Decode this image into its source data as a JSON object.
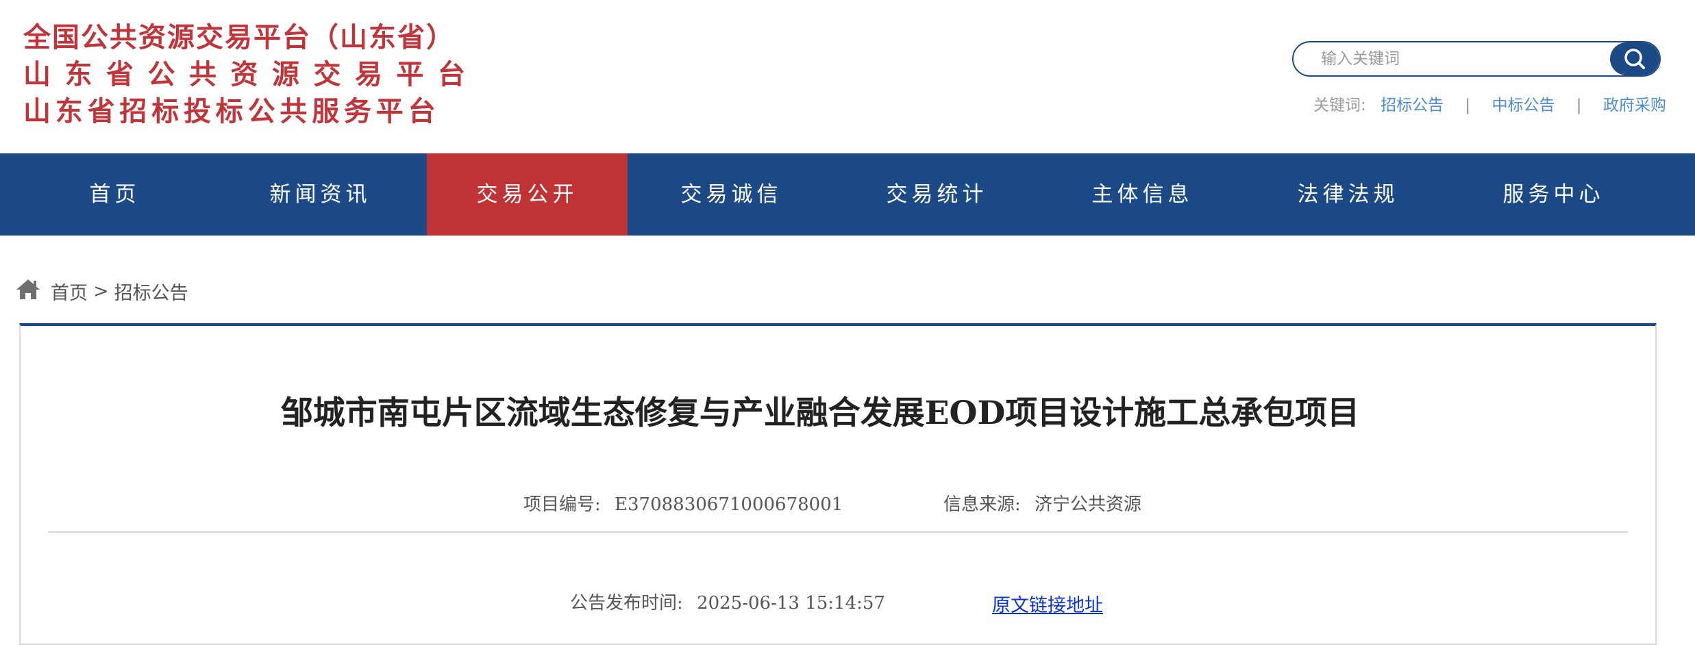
{
  "header": {
    "logo_lines": [
      "全国公共资源交易平台（山东省）",
      "山东省公共资源交易平台",
      "山东省招标投标公共服务平台"
    ],
    "search": {
      "placeholder": "输入关键词",
      "value": "",
      "button_icon": "search-icon"
    },
    "keywords": {
      "label": "关键词:",
      "items": [
        "招标公告",
        "中标公告",
        "政府采购"
      ],
      "separator": "|"
    }
  },
  "nav": {
    "items": [
      "首页",
      "新闻资讯",
      "交易公开",
      "交易诚信",
      "交易统计",
      "主体信息",
      "法律法规",
      "服务中心"
    ],
    "active_index": 2
  },
  "breadcrumb": {
    "icon": "home-icon",
    "items": [
      "首页",
      "招标公告"
    ],
    "separator": ">"
  },
  "article": {
    "title": "邹城市南屯片区流域生态修复与产业融合发展EOD项目设计施工总承包项目",
    "project_no_label": "项目编号:",
    "project_no_value": "E3708830671000678001",
    "source_label": "信息来源:",
    "source_value": "济宁公共资源",
    "publish_time_label": "公告发布时间:",
    "publish_time_value": "2025-06-13 15:14:57",
    "original_link": "原文链接地址"
  },
  "colors": {
    "brand_blue": "#1b4a86",
    "brand_red": "#bf3334",
    "logo_red": "#c0353a",
    "keyword_link": "#4a8dd6",
    "hyperlink": "#0b32d6"
  }
}
